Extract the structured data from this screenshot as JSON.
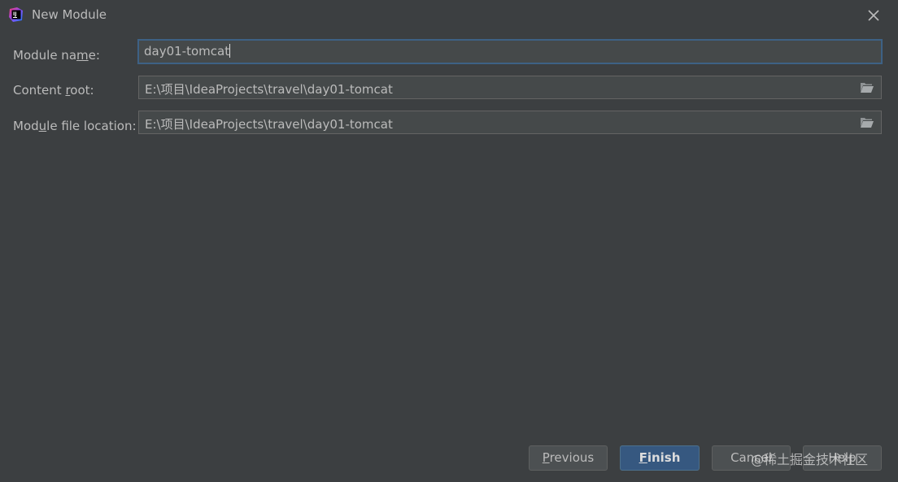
{
  "window": {
    "title": "New Module"
  },
  "form": {
    "module_name": {
      "label_pre": "Module na",
      "label_mn": "m",
      "label_post": "e:",
      "value": "day01-tomcat"
    },
    "content_root": {
      "label_pre": "Content ",
      "label_mn": "r",
      "label_post": "oot:",
      "value": "E:\\项目\\IdeaProjects\\travel\\day01-tomcat"
    },
    "module_file_location": {
      "label_pre": "Mod",
      "label_mn": "u",
      "label_post": "le file location:",
      "value": "E:\\项目\\IdeaProjects\\travel\\day01-tomcat"
    }
  },
  "buttons": {
    "previous": {
      "mn": "P",
      "rest": "revious"
    },
    "finish": {
      "mn": "F",
      "rest": "inish"
    },
    "cancel": "Cancel",
    "help": "Help"
  },
  "watermark": "@稀土掘金技术社区",
  "icons": {
    "app": "intellij-idea-icon",
    "close": "close-icon",
    "folder": "folder-open-icon"
  },
  "colors": {
    "background": "#3c3f41",
    "field_background": "#45494a",
    "focus_border": "#3d6185",
    "primary_button": "#365880"
  }
}
